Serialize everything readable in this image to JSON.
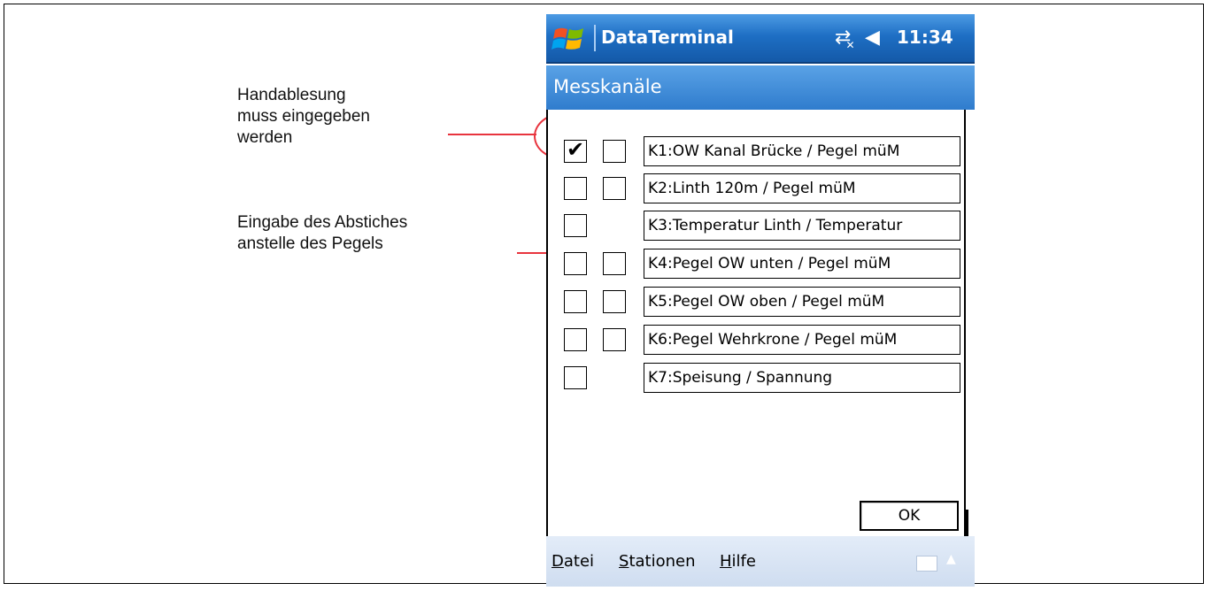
{
  "annotations": {
    "handablesung": "Handablesung\nmuss eingegeben\nwerden",
    "eingabe": "Eingabe des Abstiches\nanstelle des Pegels"
  },
  "device": {
    "app_title": "DataTerminal",
    "tray": {
      "connectivity_icon": "connectivity-off-icon",
      "volume_icon": "volume-muted-icon"
    },
    "time": "11:34",
    "header_title": "Messkanäle",
    "channels": [
      {
        "label": "K1:OW Kanal Brücke / Pegel müM",
        "manual": true,
        "has_abstich": true,
        "abstich": false
      },
      {
        "label": "K2:Linth 120m  / Pegel müM",
        "manual": false,
        "has_abstich": true,
        "abstich": false
      },
      {
        "label": "K3:Temperatur Linth / Temperatur",
        "manual": false,
        "has_abstich": false,
        "abstich": false
      },
      {
        "label": "K4:Pegel OW unten / Pegel müM",
        "manual": false,
        "has_abstich": true,
        "abstich": false
      },
      {
        "label": "K5:Pegel OW oben / Pegel müM",
        "manual": false,
        "has_abstich": true,
        "abstich": false
      },
      {
        "label": "K6:Pegel Wehrkrone / Pegel müM",
        "manual": false,
        "has_abstich": true,
        "abstich": false
      },
      {
        "label": "K7:Speisung / Spannung",
        "manual": false,
        "has_abstich": false,
        "abstich": false
      }
    ],
    "ok_label": "OK",
    "menu": [
      {
        "accel": "D",
        "rest": "atei"
      },
      {
        "accel": "S",
        "rest": "tationen"
      },
      {
        "accel": "H",
        "rest": "ilfe"
      }
    ]
  },
  "colors": {
    "annotation_red": "#e8343e",
    "titlebar_blue": "#1e6fc4"
  }
}
